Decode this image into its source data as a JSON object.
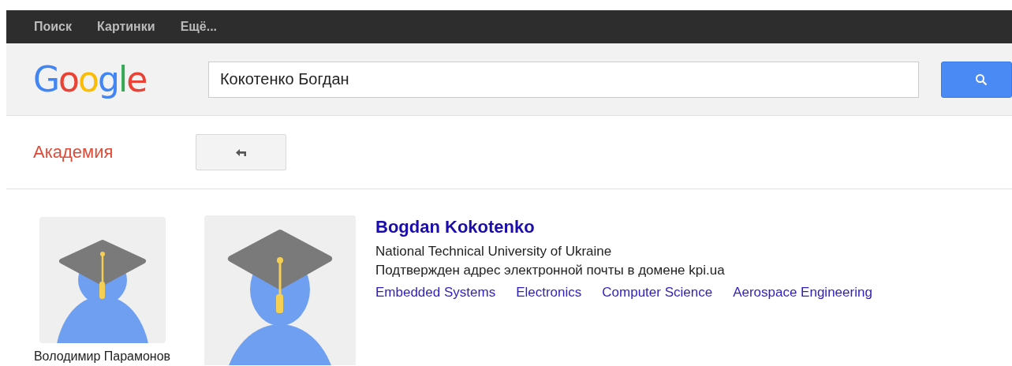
{
  "top_nav": [
    {
      "label": "Поиск"
    },
    {
      "label": "Картинки"
    },
    {
      "label": "Ещё..."
    }
  ],
  "logo": "Google",
  "search": {
    "value": "Кокотенко Богдан"
  },
  "section": "Академия",
  "coauthor": {
    "name": "Володимир Парамонов"
  },
  "profile": {
    "name": "Bogdan Kokotenko",
    "affiliation": "National Technical University of Ukraine",
    "email_note": "Подтвержден адрес электронной почты в домене kpi.ua",
    "interests": [
      "Embedded Systems",
      "Electronics",
      "Computer Science",
      "Aerospace Engineering"
    ]
  }
}
